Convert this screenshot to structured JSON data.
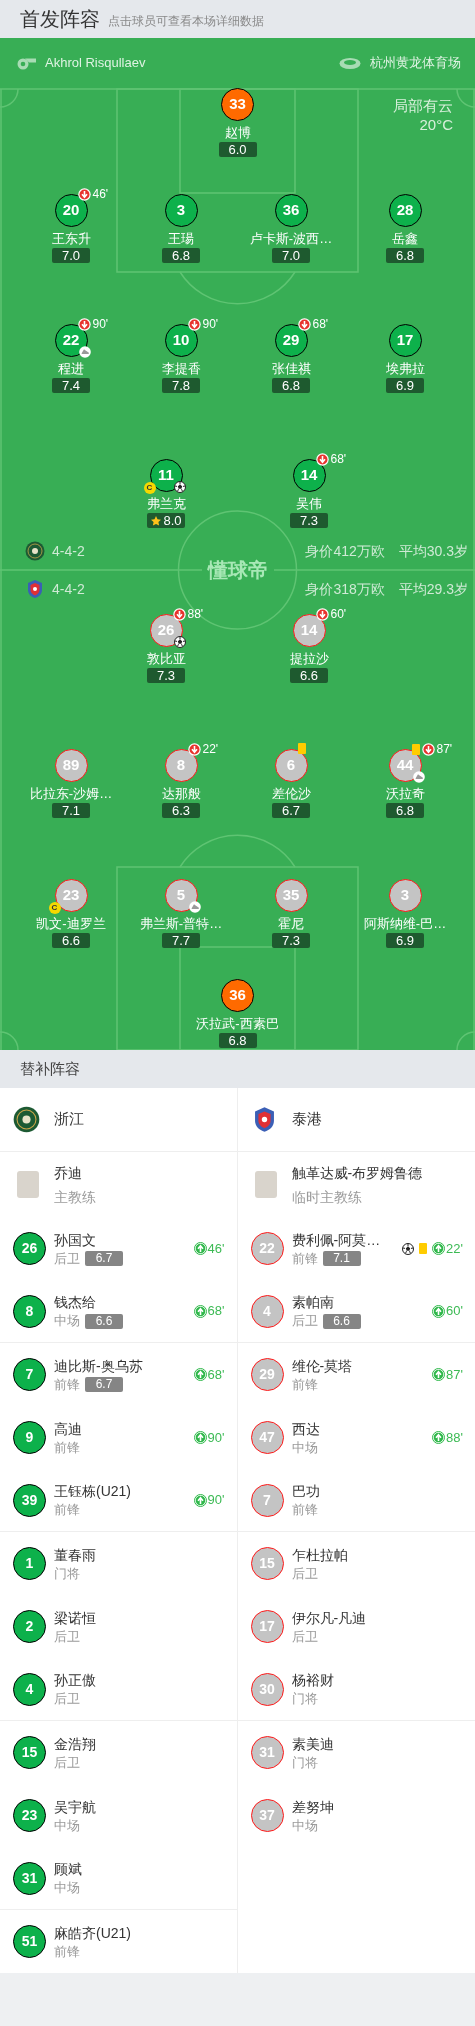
{
  "header": {
    "title": "首发阵容",
    "hint": "点击球员可查看本场详细数据"
  },
  "match_info": {
    "referee": "Akhrol Risqullaev",
    "stadium": "杭州黄龙体育场",
    "weather": "局部有云",
    "temperature": "20°C"
  },
  "pitch_logo": "懂球帝",
  "home": {
    "kind": "home",
    "formation": "4-4-2",
    "market_value": "身价412万欧",
    "average_age": "平均30.3岁",
    "lines": [
      [
        {
          "number": "33",
          "name": "赵博",
          "rating": "6.0",
          "kind": "keeper"
        }
      ],
      [
        {
          "number": "20",
          "name": "王东升",
          "rating": "7.0",
          "kind": "outfield",
          "events": [
            {
              "kind": "sub_off",
              "minute": "46'"
            }
          ]
        },
        {
          "number": "3",
          "name": "王瑒",
          "rating": "6.8",
          "kind": "outfield"
        },
        {
          "number": "36",
          "name": "卢卡斯-波西…",
          "rating": "7.0",
          "kind": "outfield"
        },
        {
          "number": "28",
          "name": "岳鑫",
          "rating": "6.8",
          "kind": "outfield"
        }
      ],
      [
        {
          "number": "22",
          "name": "程进",
          "rating": "7.4",
          "kind": "outfield",
          "events": [
            {
              "kind": "sub_off",
              "minute": "90'"
            },
            {
              "kind": "assist"
            }
          ]
        },
        {
          "number": "10",
          "name": "李提香",
          "rating": "7.8",
          "kind": "outfield",
          "events": [
            {
              "kind": "sub_off",
              "minute": "90'"
            }
          ]
        },
        {
          "number": "29",
          "name": "张佳祺",
          "rating": "6.8",
          "kind": "outfield",
          "events": [
            {
              "kind": "sub_off",
              "minute": "68'"
            }
          ]
        },
        {
          "number": "17",
          "name": "埃弗拉",
          "rating": "6.9",
          "kind": "outfield"
        }
      ],
      [
        {
          "number": "11",
          "name": "弗兰克",
          "rating": "8.0",
          "kind": "outfield",
          "best": true,
          "events": [
            {
              "kind": "captain",
              "label": "C"
            },
            {
              "kind": "goal"
            }
          ]
        },
        {
          "number": "14",
          "name": "吴伟",
          "rating": "7.3",
          "kind": "outfield",
          "events": [
            {
              "kind": "sub_off",
              "minute": "68'"
            }
          ]
        }
      ]
    ]
  },
  "away": {
    "kind": "away",
    "formation": "4-4-2",
    "market_value": "身价318万欧",
    "average_age": "平均29.3岁",
    "lines": [
      [
        {
          "number": "26",
          "name": "敦比亚",
          "rating": "7.3",
          "kind": "outfield",
          "events": [
            {
              "kind": "sub_off",
              "minute": "88'"
            },
            {
              "kind": "goal"
            }
          ]
        },
        {
          "number": "14",
          "name": "提拉沙",
          "rating": "6.6",
          "kind": "outfield",
          "events": [
            {
              "kind": "sub_off",
              "minute": "60'"
            }
          ]
        }
      ],
      [
        {
          "number": "89",
          "name": "比拉东-沙姆…",
          "rating": "7.1",
          "kind": "outfield"
        },
        {
          "number": "8",
          "name": "达那般",
          "rating": "6.3",
          "kind": "outfield",
          "events": [
            {
              "kind": "sub_off",
              "minute": "22'"
            }
          ]
        },
        {
          "number": "6",
          "name": "差伦沙",
          "rating": "6.7",
          "kind": "outfield",
          "events": [
            {
              "kind": "yellow_card"
            }
          ]
        },
        {
          "number": "44",
          "name": "沃拉奇",
          "rating": "6.8",
          "kind": "outfield",
          "events": [
            {
              "kind": "yellow_card"
            },
            {
              "kind": "sub_off",
              "minute": "87'"
            },
            {
              "kind": "assist"
            }
          ]
        }
      ],
      [
        {
          "number": "23",
          "name": "凯文-迪罗兰",
          "rating": "6.6",
          "kind": "outfield",
          "events": [
            {
              "kind": "captain",
              "label": "C"
            }
          ]
        },
        {
          "number": "5",
          "name": "弗兰斯-普特…",
          "rating": "7.7",
          "kind": "outfield",
          "events": [
            {
              "kind": "assist"
            }
          ]
        },
        {
          "number": "35",
          "name": "霍尼",
          "rating": "7.3",
          "kind": "outfield"
        },
        {
          "number": "3",
          "name": "阿斯纳维-巴…",
          "rating": "6.9",
          "kind": "outfield"
        }
      ],
      [
        {
          "number": "36",
          "name": "沃拉武-西素巴",
          "rating": "6.8",
          "kind": "keeper"
        }
      ]
    ]
  },
  "substitutes": {
    "title": "替补阵容",
    "teams": [
      {
        "kind": "home",
        "name": "浙江",
        "coach": {
          "name": "乔迪",
          "role": "主教练"
        },
        "players": [
          {
            "number": "26",
            "name": "孙国文",
            "position": "后卫",
            "rating": "6.7",
            "events": [
              {
                "kind": "sub_on",
                "minute": "46'"
              }
            ]
          },
          {
            "number": "8",
            "name": "钱杰给",
            "position": "中场",
            "rating": "6.6",
            "events": [
              {
                "kind": "sub_on",
                "minute": "68'"
              }
            ]
          },
          {
            "number": "7",
            "name": "迪比斯-奥乌苏",
            "position": "前锋",
            "rating": "6.7",
            "events": [
              {
                "kind": "sub_on",
                "minute": "68'"
              }
            ]
          },
          {
            "number": "9",
            "name": "高迪",
            "position": "前锋",
            "events": [
              {
                "kind": "sub_on",
                "minute": "90'"
              }
            ]
          },
          {
            "number": "39",
            "name": "王钰栋(U21)",
            "position": "前锋",
            "events": [
              {
                "kind": "sub_on",
                "minute": "90'"
              }
            ]
          },
          {
            "number": "1",
            "name": "董春雨",
            "position": "门将"
          },
          {
            "number": "2",
            "name": "梁诺恒",
            "position": "后卫"
          },
          {
            "number": "4",
            "name": "孙正傲",
            "position": "后卫"
          },
          {
            "number": "15",
            "name": "金浩翔",
            "position": "后卫"
          },
          {
            "number": "23",
            "name": "吴宇航",
            "position": "中场"
          },
          {
            "number": "31",
            "name": "顾斌",
            "position": "中场"
          },
          {
            "number": "51",
            "name": "麻皓齐(U21)",
            "position": "前锋"
          }
        ]
      },
      {
        "kind": "away",
        "name": "泰港",
        "coach": {
          "name": "触革达威-布罗姆鲁德",
          "role": "临时主教练"
        },
        "players": [
          {
            "number": "22",
            "name": "费利佩-阿莫…",
            "position": "前锋",
            "rating": "7.1",
            "events": [
              {
                "kind": "goal"
              },
              {
                "kind": "yellow_card"
              },
              {
                "kind": "sub_on",
                "minute": "22'"
              }
            ]
          },
          {
            "number": "4",
            "name": "素帕南",
            "position": "后卫",
            "rating": "6.6",
            "events": [
              {
                "kind": "sub_on",
                "minute": "60'"
              }
            ]
          },
          {
            "number": "29",
            "name": "维伦-莫塔",
            "position": "前锋",
            "events": [
              {
                "kind": "sub_on",
                "minute": "87'"
              }
            ]
          },
          {
            "number": "47",
            "name": "西达",
            "position": "中场",
            "events": [
              {
                "kind": "sub_on",
                "minute": "88'"
              }
            ]
          },
          {
            "number": "7",
            "name": "巴功",
            "position": "前锋"
          },
          {
            "number": "15",
            "name": "乍杜拉帕",
            "position": "后卫"
          },
          {
            "number": "17",
            "name": "伊尔凡-凡迪",
            "position": "后卫"
          },
          {
            "number": "30",
            "name": "杨裕财",
            "position": "门将"
          },
          {
            "number": "31",
            "name": "素美迪",
            "position": "门将"
          },
          {
            "number": "37",
            "name": "差努坤",
            "position": "中场"
          }
        ]
      }
    ]
  }
}
